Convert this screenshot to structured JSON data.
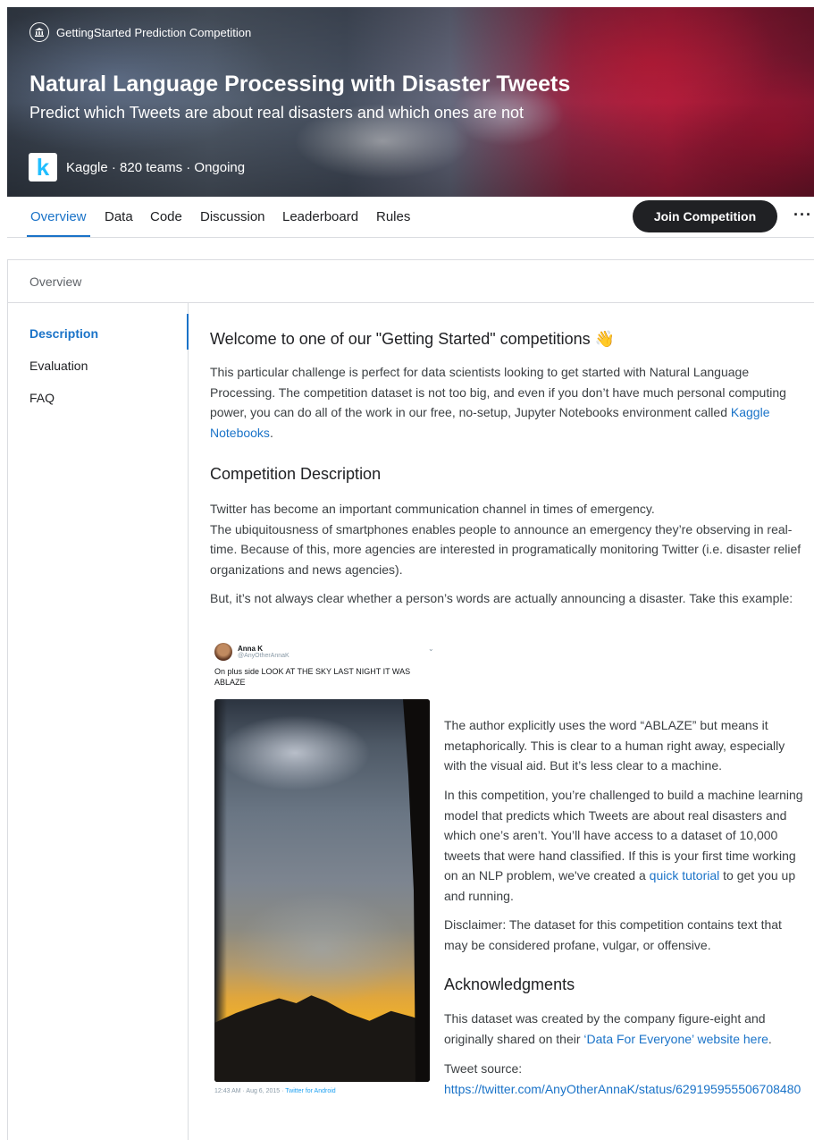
{
  "hero": {
    "kind": "GettingStarted Prediction Competition",
    "title": "Natural Language Processing with Disaster Tweets",
    "subtitle": "Predict which Tweets are about real disasters and which ones are not",
    "host_logo_letter": "k",
    "host_line": "Kaggle · 820 teams · Ongoing"
  },
  "tabs": [
    {
      "label": "Overview"
    },
    {
      "label": "Data"
    },
    {
      "label": "Code"
    },
    {
      "label": "Discussion"
    },
    {
      "label": "Leaderboard"
    },
    {
      "label": "Rules"
    }
  ],
  "actions": {
    "join_label": "Join Competition",
    "more_label": "···"
  },
  "section_header": "Overview",
  "sidebar": [
    {
      "label": "Description"
    },
    {
      "label": "Evaluation"
    },
    {
      "label": "FAQ"
    }
  ],
  "content": {
    "welcome_heading": "Welcome to one of our \"Getting Started\" competitions 👋",
    "intro": "This particular challenge is perfect for data scientists looking to get started with Natural Language Processing. The competition dataset is not too big, and even if you don’t have much personal computing power, you can do all of the work in our free, no-setup, Jupyter Notebooks environment called ",
    "intro_link": "Kaggle Notebooks",
    "intro_end": ".",
    "desc_heading": "Competition Description",
    "desc_p1_line1": "Twitter has become an important communication channel in times of emergency.",
    "desc_p1_line2": "The ubiquitousness of smartphones enables people to announce an emergency they’re observing in real-time. Because of this, more agencies are interested in programatically monitoring Twitter (i.e. disaster relief organizations and news agencies).",
    "desc_p2": "But, it’s not always clear whether a person’s words are actually announcing a disaster. Take this example:",
    "author_note": "The author explicitly uses the word “ABLAZE” but means it metaphorically. This is clear to a human right away, especially with the visual aid. But it’s less clear to a machine.",
    "challenge": "In this competition, you’re challenged to build a machine learning model that predicts which Tweets are about real disasters and which one’s aren’t. You’ll have access to a dataset of 10,000 tweets that were hand classified. If this is your first time working on an NLP problem, we've created a ",
    "challenge_link": "quick tutorial",
    "challenge_end": " to get you up and running.",
    "disclaimer": "Disclaimer: The dataset for this competition contains text that may be considered profane, vulgar, or offensive.",
    "ack_heading": "Acknowledgments",
    "ack_text": "This dataset was created by the company figure-eight and originally shared on their ",
    "ack_link": "‘Data For Everyone’ website here",
    "ack_end": ".",
    "source_label": "Tweet source:",
    "source_link": "https://twitter.com/AnyOtherAnnaK/status/629195955506708480"
  },
  "tweet": {
    "name": "Anna K",
    "handle": "@AnyOtherAnnaK",
    "text": "On plus side LOOK AT THE SKY LAST NIGHT IT WAS ABLAZE",
    "time": "12:43 AM · Aug 6, 2015 · ",
    "client": "Twitter for Android"
  },
  "colors": {
    "accent": "#1a73c8",
    "button_bg": "#202124",
    "kaggle_blue": "#20beff"
  }
}
